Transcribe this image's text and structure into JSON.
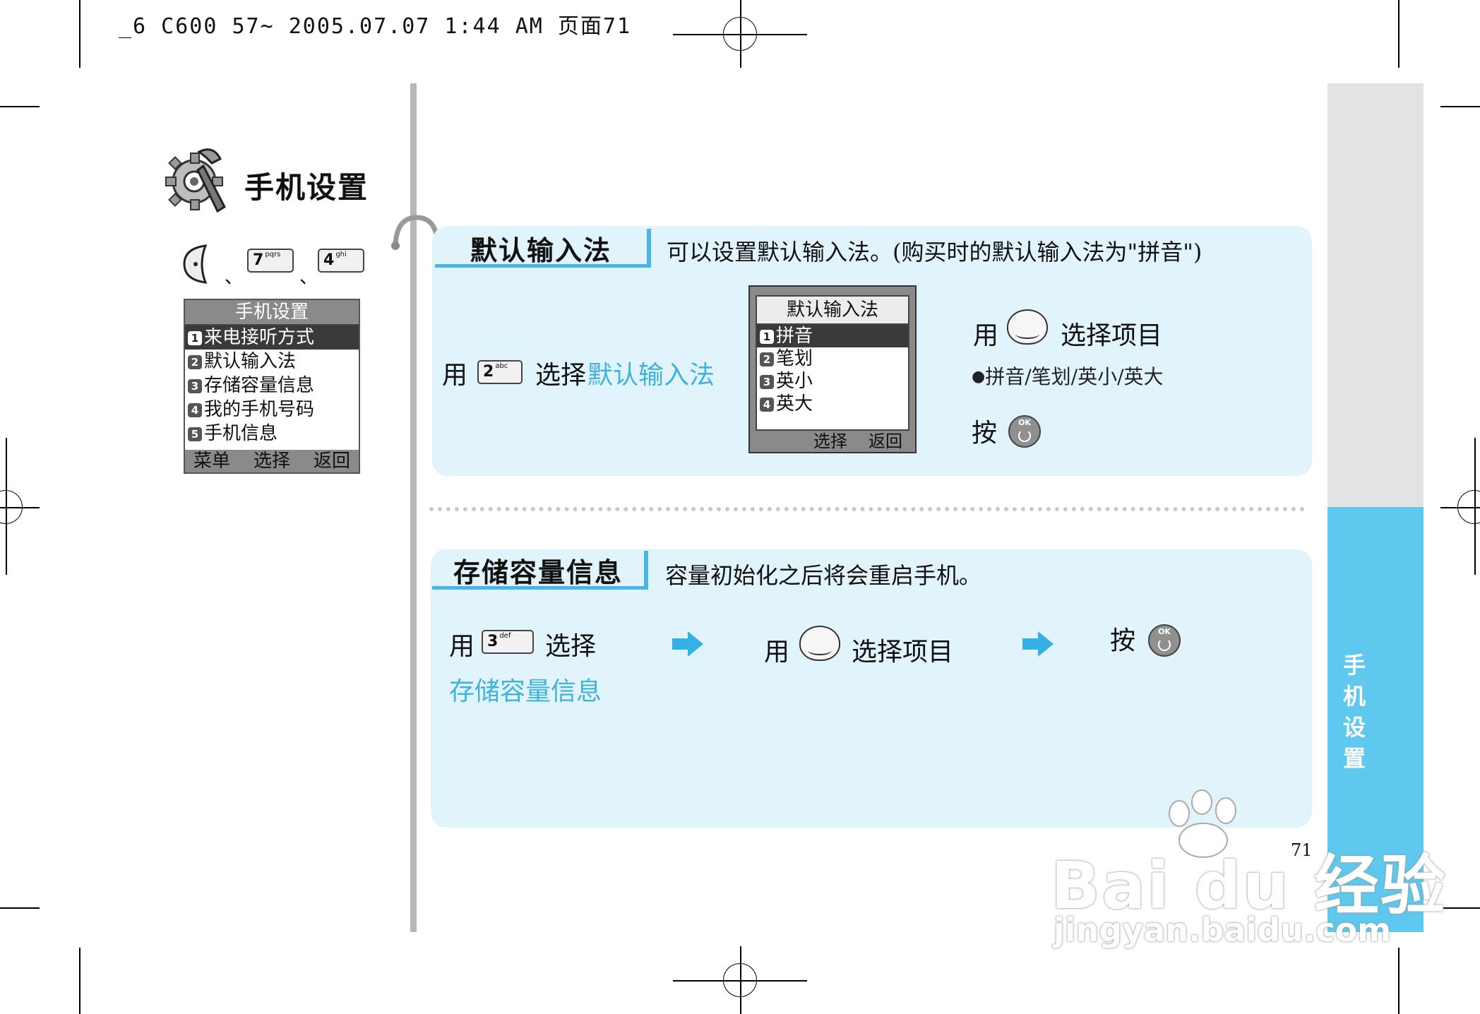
{
  "print_header": "_6 C600 57~ 2005.07.07 1:44 AM 页面71",
  "chapter": {
    "title": "手机设置",
    "icon": "gear-wrench-icon"
  },
  "navigation": {
    "separator": "、",
    "key1": {
      "digit": "7",
      "letters": "pqrs"
    },
    "key2": {
      "digit": "4",
      "letters": "ghi"
    }
  },
  "phone_menu": {
    "title": "手机设置",
    "items": [
      {
        "num": "1",
        "label": "来电接听方式"
      },
      {
        "num": "2",
        "label": "默认输入法"
      },
      {
        "num": "3",
        "label": "存储容量信息"
      },
      {
        "num": "4",
        "label": "我的手机号码"
      },
      {
        "num": "5",
        "label": "手机信息"
      }
    ],
    "footer": {
      "left": "菜单",
      "center": "选择",
      "right": "返回"
    }
  },
  "section1": {
    "heading": "默认输入法",
    "description": "可以设置默认输入法。(购买时的默认输入法为\"拼音\")",
    "step_use": "用",
    "key": {
      "digit": "2",
      "letters": "abc"
    },
    "step_select": "选择",
    "step_highlight": "默认输入法",
    "screen": {
      "title": "默认输入法",
      "items": [
        {
          "num": "1",
          "label": "拼音"
        },
        {
          "num": "2",
          "label": "笔划"
        },
        {
          "num": "3",
          "label": "英小"
        },
        {
          "num": "4",
          "label": "英大"
        }
      ],
      "footer": {
        "center": "选择",
        "right": "返回"
      }
    },
    "nav_use": "用",
    "nav_select": "选择项目",
    "options": "拼音/笔划/英小/英大",
    "press": "按",
    "ok_label": "OK"
  },
  "section2": {
    "heading": "存储容量信息",
    "description": "容量初始化之后将会重启手机。",
    "step_use": "用",
    "key": {
      "digit": "3",
      "letters": "def"
    },
    "step_select": "选择",
    "step_highlight": "存储容量信息",
    "nav_use": "用",
    "nav_select": "选择项目",
    "press": "按",
    "ok_label": "OK"
  },
  "side_tab": {
    "label": "手机设置"
  },
  "page_number": "71",
  "watermark": {
    "brand": "Bai du 经验",
    "url": "jingyan.baidu.com"
  },
  "colors": {
    "accent": "#4ab4e6",
    "panel": "#e2f4fb",
    "side_tab": "#5ec8ee"
  }
}
